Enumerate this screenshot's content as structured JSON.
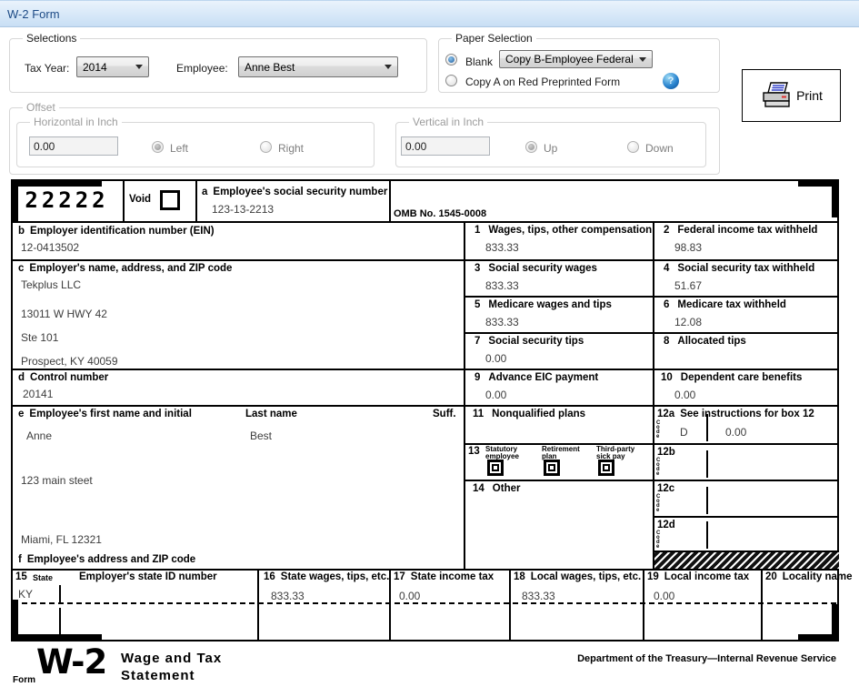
{
  "window": {
    "title": "W-2 Form"
  },
  "selections": {
    "label": "Selections",
    "tax_year_label": "Tax Year:",
    "tax_year_value": "2014",
    "employee_label": "Employee:",
    "employee_value": "Anne Best"
  },
  "paper": {
    "label": "Paper Selection",
    "blank": "Blank",
    "copy_value": "Copy B-Employee Federal",
    "copy_a": "Copy A on Red Preprinted Form",
    "help_glyph": "?"
  },
  "print": {
    "label": "Print"
  },
  "offset": {
    "label": "Offset",
    "horizontal": {
      "label": "Horizontal in Inch",
      "value": "0.00",
      "left": "Left",
      "right": "Right"
    },
    "vertical": {
      "label": "Vertical in Inch",
      "value": "0.00",
      "up": "Up",
      "down": "Down"
    }
  },
  "form": {
    "control_code": "22222",
    "void_label": "Void",
    "code_label": "Code",
    "omb": "OMB No. 1545-0008",
    "box_a": {
      "prefix": "a",
      "label": "Employee's social security number",
      "value": "123-13-2213"
    },
    "box_b": {
      "prefix": "b",
      "label": "Employer identification number (EIN)",
      "value": "12-0413502"
    },
    "box_c": {
      "prefix": "c",
      "label": "Employer's name, address, and ZIP code",
      "lines": [
        "Tekplus LLC",
        "13011 W HWY 42",
        "Ste 101",
        "Prospect, KY 40059"
      ]
    },
    "box_d": {
      "prefix": "d",
      "label": "Control number",
      "value": "20141"
    },
    "box_e": {
      "prefix": "e",
      "label": "Employee's first name and initial",
      "last_label": "Last name",
      "suff_label": "Suff.",
      "first_name": "Anne",
      "last_name": "Best",
      "street": "123 main steet",
      "city": "Miami, FL 12321"
    },
    "box_f": {
      "prefix": "f",
      "label": "Employee's address and ZIP code"
    },
    "box1": {
      "num": "1",
      "label": "Wages, tips, other compensation",
      "value": "833.33"
    },
    "box2": {
      "num": "2",
      "label": "Federal income tax withheld",
      "value": "98.83"
    },
    "box3": {
      "num": "3",
      "label": "Social security wages",
      "value": "833.33"
    },
    "box4": {
      "num": "4",
      "label": "Social security tax withheld",
      "value": "51.67"
    },
    "box5": {
      "num": "5",
      "label": "Medicare wages and tips",
      "value": "833.33"
    },
    "box6": {
      "num": "6",
      "label": "Medicare tax withheld",
      "value": "12.08"
    },
    "box7": {
      "num": "7",
      "label": "Social security tips",
      "value": "0.00"
    },
    "box8": {
      "num": "8",
      "label": "Allocated tips",
      "value": ""
    },
    "box9": {
      "num": "9",
      "label": "Advance EIC payment",
      "value": "0.00"
    },
    "box10": {
      "num": "10",
      "label": "Dependent care benefits",
      "value": "0.00"
    },
    "box11": {
      "num": "11",
      "label": "Nonqualified plans",
      "value": ""
    },
    "box12a": {
      "num": "12a",
      "label": "See instructions for box 12",
      "code": "D",
      "value": "0.00"
    },
    "box12b": {
      "num": "12b"
    },
    "box12c": {
      "num": "12c"
    },
    "box12d": {
      "num": "12d"
    },
    "box13": {
      "num": "13",
      "items": [
        {
          "l1": "Statutory",
          "l2": "employee"
        },
        {
          "l1": "Retirement",
          "l2": "plan"
        },
        {
          "l1": "Third-party",
          "l2": "sick pay"
        }
      ]
    },
    "box14": {
      "num": "14",
      "label": "Other"
    },
    "box15": {
      "num": "15",
      "state_label": "State",
      "state_value": "KY",
      "id_label": "Employer's state ID number"
    },
    "box16": {
      "num": "16",
      "label": "State wages, tips, etc.",
      "value": "833.33"
    },
    "box17": {
      "num": "17",
      "label": "State income tax",
      "value": "0.00"
    },
    "box18": {
      "num": "18",
      "label": "Local wages, tips, etc.",
      "value": "833.33"
    },
    "box19": {
      "num": "19",
      "label": "Local income tax",
      "value": "0.00"
    },
    "box20": {
      "num": "20",
      "label": "Locality name",
      "value": ""
    }
  },
  "footer": {
    "form_label": "Form",
    "form_number": "W-2",
    "title_line1": "Wage and Tax",
    "title_line2": "Statement",
    "department": "Department of the Treasury—Internal Revenue Service"
  }
}
